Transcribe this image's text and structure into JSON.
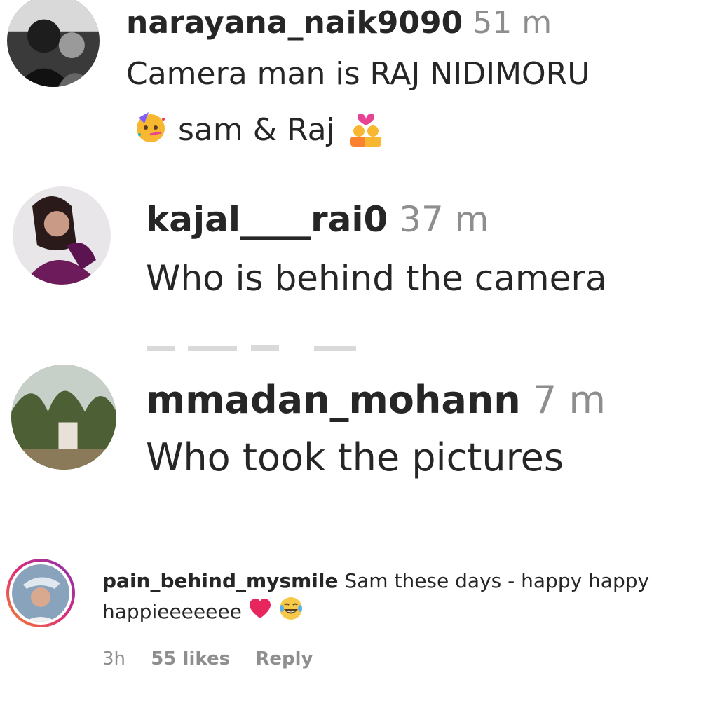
{
  "comments": [
    {
      "username": "narayana_naik9090",
      "time": "51 m",
      "text_line1": "Camera man is RAJ NIDIMORU",
      "text_line2": "sam & Raj"
    },
    {
      "username": "kajal____rai0",
      "time": "37 m",
      "text": "Who is behind the camera"
    },
    {
      "username": "mmadan_mohann",
      "time": "7 m",
      "text": "Who took the pictures"
    },
    {
      "username": "pain_behind_mysmile",
      "text": "Sam these days - happy happy happieeeeeee",
      "age": "3h",
      "likes": "55 likes",
      "reply_label": "Reply"
    }
  ],
  "icons": [
    "partying-face-icon",
    "couple-with-heart-icon",
    "heart-icon",
    "laughing-face-icon"
  ],
  "colors": {
    "text": "#262626",
    "muted": "#8e8e8e",
    "story_ring": "#d6249f",
    "heart": "#e8265e"
  }
}
